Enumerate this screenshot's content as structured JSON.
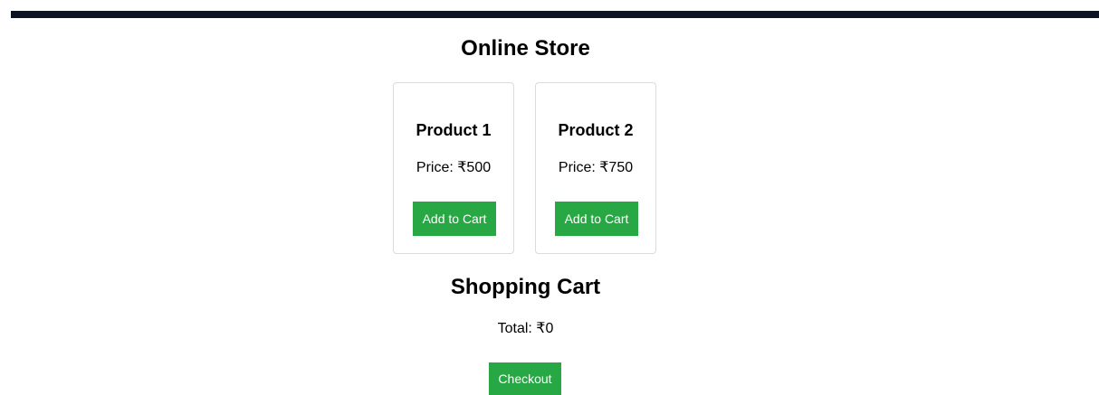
{
  "header": {
    "title": "Online Store"
  },
  "products": [
    {
      "name": "Product 1",
      "price_label": "Price: ₹500",
      "button_label": "Add to Cart"
    },
    {
      "name": "Product 2",
      "price_label": "Price: ₹750",
      "button_label": "Add to Cart"
    }
  ],
  "cart": {
    "title": "Shopping Cart",
    "total_label": "Total: ₹0",
    "checkout_label": "Checkout"
  },
  "colors": {
    "top_bar": "#0b1220",
    "button": "#28a745",
    "button_text": "#ffffff",
    "card_border": "#dcdcdc"
  }
}
